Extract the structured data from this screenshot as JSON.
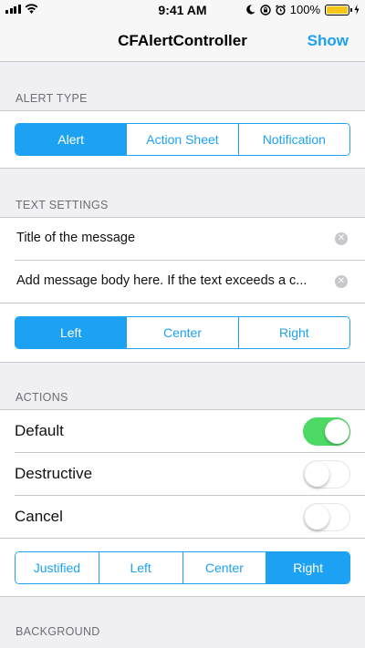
{
  "status_bar": {
    "time": "9:41 AM",
    "battery": "100%",
    "icons": [
      "signal-icon",
      "wifi-icon",
      "moon-icon",
      "lock-rotation-icon",
      "alarm-icon",
      "battery-icon",
      "charging-icon"
    ]
  },
  "nav": {
    "title": "CFAlertController",
    "show_label": "Show"
  },
  "alert_type": {
    "header": "ALERT TYPE",
    "options": [
      "Alert",
      "Action Sheet",
      "Notification"
    ],
    "selected": "Alert"
  },
  "text_settings": {
    "header": "TEXT SETTINGS",
    "title_value": "Title of the message",
    "message_value": "Add message body here. If the text exceeds a c...",
    "alignment": [
      "Left",
      "Center",
      "Right"
    ],
    "selected": "Left"
  },
  "actions": {
    "header": "ACTIONS",
    "toggles": [
      {
        "label": "Default",
        "on": true
      },
      {
        "label": "Destructive",
        "on": false
      },
      {
        "label": "Cancel",
        "on": false
      }
    ],
    "alignment": [
      "Justified",
      "Left",
      "Center",
      "Right"
    ],
    "selected": "Right"
  },
  "background": {
    "header": "BACKGROUND"
  },
  "colors": {
    "accent": "#1da1f2",
    "switch_on": "#4cd964",
    "battery": "#f5c518"
  }
}
